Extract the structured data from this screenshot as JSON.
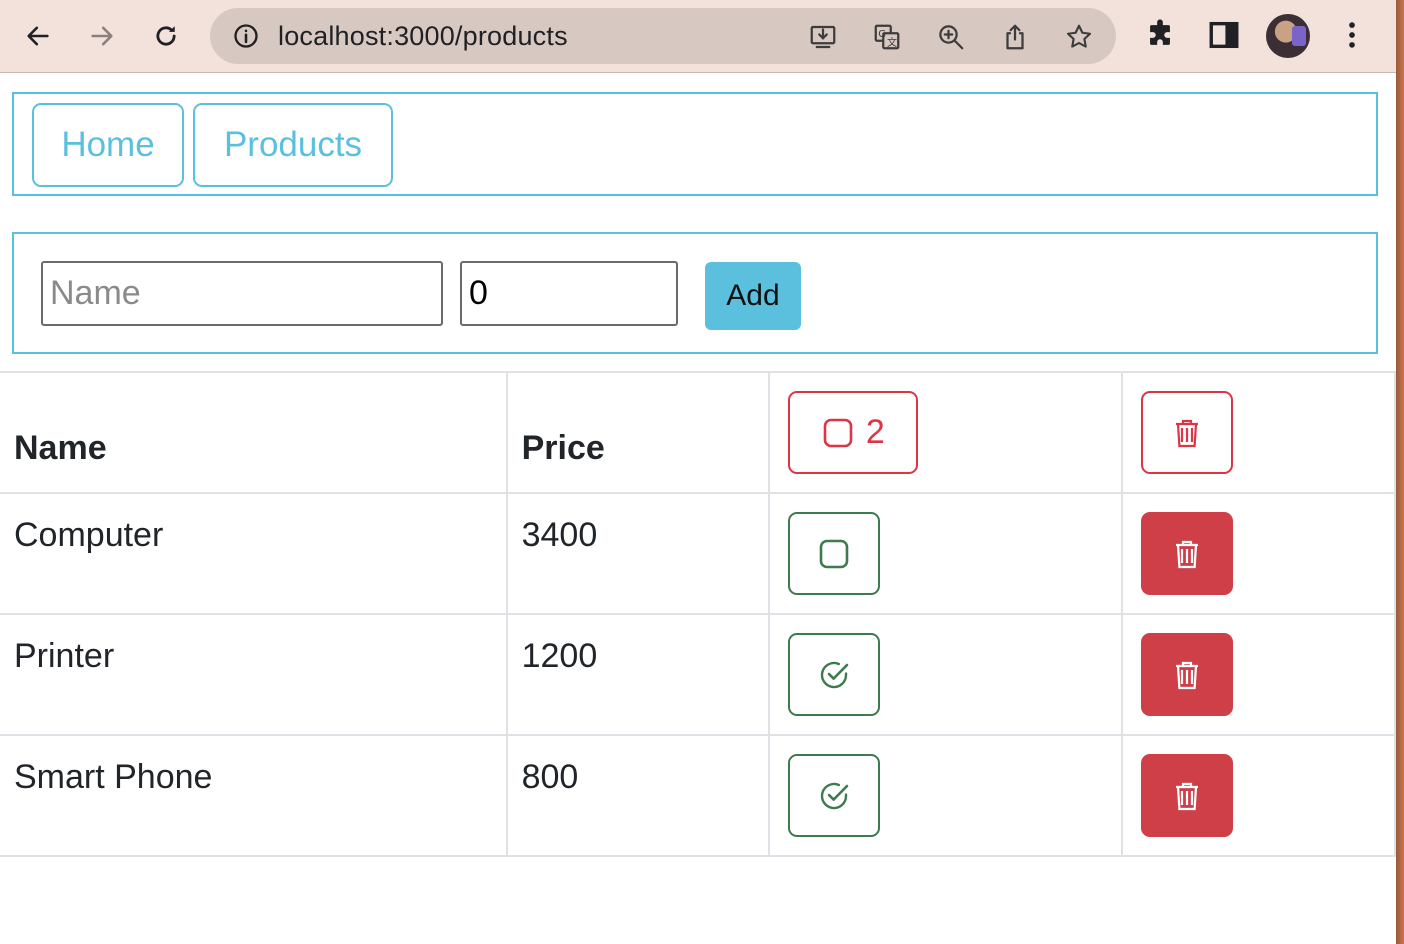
{
  "browser": {
    "url": "localhost:3000/products",
    "icons": [
      "back-icon",
      "forward-icon",
      "reload-icon",
      "info-icon",
      "install-icon",
      "translate-icon",
      "zoom-icon",
      "share-icon",
      "bookmark-star-icon",
      "extensions-icon",
      "side-panel-icon",
      "menu-dots-icon"
    ]
  },
  "nav": {
    "home_label": "Home",
    "products_label": "Products"
  },
  "form": {
    "name_placeholder": "Name",
    "price_value": "0",
    "add_label": "Add"
  },
  "table": {
    "headers": {
      "name": "Name",
      "price": "Price",
      "checked_count": "2"
    },
    "rows": [
      {
        "name": "Computer",
        "price": "3400",
        "checked": false
      },
      {
        "name": "Printer",
        "price": "1200",
        "checked": true
      },
      {
        "name": "Smart Phone",
        "price": "800",
        "checked": true
      }
    ]
  },
  "colors": {
    "accent": "#5bc0de",
    "danger": "#dc3545",
    "success": "#3d7a4f"
  }
}
